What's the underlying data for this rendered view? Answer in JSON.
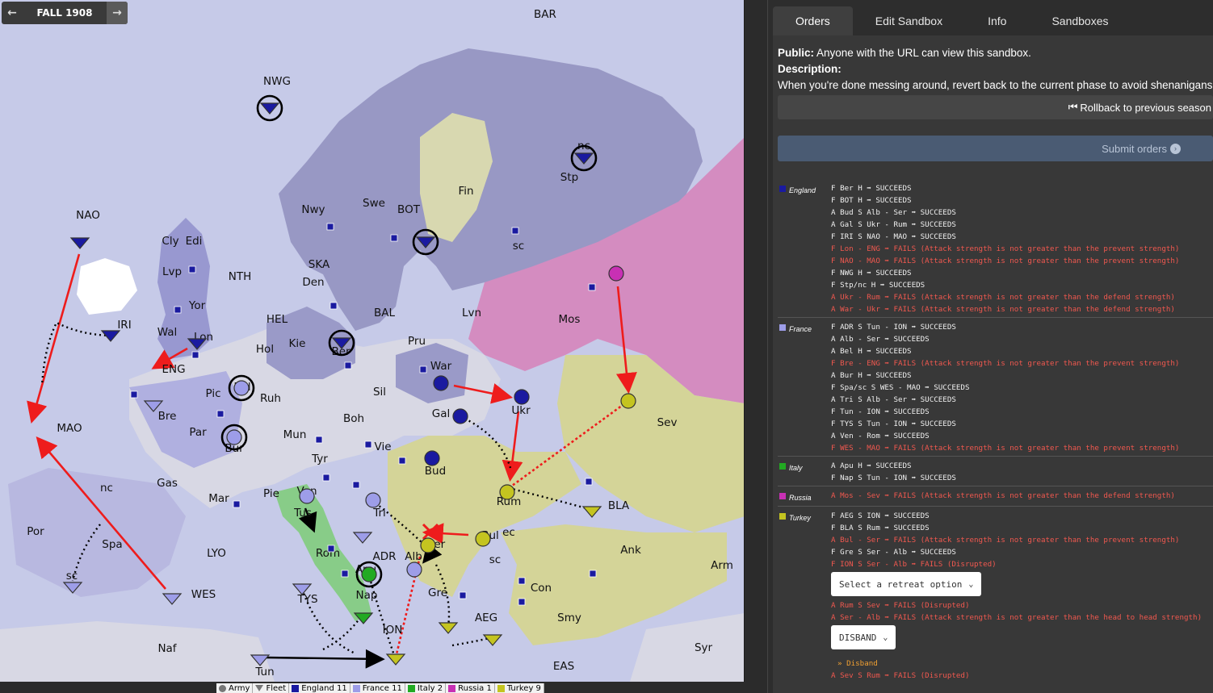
{
  "season": {
    "label": "FALL 1908",
    "prev_icon": "arrow-left-icon",
    "next_icon": "arrow-right-icon"
  },
  "colors": {
    "sea": "#c6cae8",
    "land": "#dcdce6",
    "england": "#1a1aa0",
    "france": "#9d9de8",
    "italy": "#22aa22",
    "russia": "#c830b4",
    "turkey": "#c4c420"
  },
  "map_labels": [
    "BAR",
    "NWG",
    "NAO",
    "Cly",
    "Edi",
    "Lvp",
    "Yor",
    "NTH",
    "Wal",
    "IRI",
    "Lon",
    "ENG",
    "Bre",
    "Pic",
    "Bel",
    "Hol",
    "HEL",
    "Kie",
    "Ber",
    "BAL",
    "Den",
    "SKA",
    "Nwy",
    "Swe",
    "BOT",
    "Fin",
    "Stp",
    "nc",
    "sc",
    "Lvn",
    "Mos",
    "Pru",
    "War",
    "Sil",
    "Ruh",
    "Bur",
    "Par",
    "Gas",
    "Mun",
    "Boh",
    "Tyr",
    "Vie",
    "Gal",
    "Ukr",
    "Sev",
    "Bud",
    "Rum",
    "Ser",
    "Bul",
    "ec",
    "sc",
    "BLA",
    "Ank",
    "Arm",
    "Con",
    "Smy",
    "Syr",
    "AEG",
    "EAS",
    "Gre",
    "Alb",
    "ION",
    "ADR",
    "Apu",
    "Nap",
    "Rom",
    "Tus",
    "Ven",
    "Tri",
    "Pie",
    "Mar",
    "Spa",
    "nc",
    "sc",
    "Por",
    "MAO",
    "LYO",
    "WES",
    "TYS",
    "Naf",
    "Tun"
  ],
  "legend": [
    {
      "label": "Army",
      "kind": "army"
    },
    {
      "label": "Fleet",
      "kind": "fleet"
    },
    {
      "label": "England 11",
      "color": "#1a1aa0"
    },
    {
      "label": "France 11",
      "color": "#9d9de8"
    },
    {
      "label": "Italy 2",
      "color": "#22aa22"
    },
    {
      "label": "Russia 1",
      "color": "#c830b4"
    },
    {
      "label": "Turkey 9",
      "color": "#c4c420"
    }
  ],
  "tabs": [
    "Orders",
    "Edit Sandbox",
    "Info",
    "Sandboxes"
  ],
  "info": {
    "public_label": "Public:",
    "public_text": "Anyone with the URL can view this sandbox.",
    "description_label": "Description:",
    "description_text": "When you're done messing around, revert back to the current phase to avoid shenanigans"
  },
  "rollback_label": "Rollback to previous season",
  "submit_label": "Submit orders",
  "nations": [
    {
      "name": "England",
      "color": "#1a1aa0",
      "orders": [
        {
          "text": "F Ber H ➡ SUCCEEDS",
          "fail": false
        },
        {
          "text": "F BOT H ➡ SUCCEEDS",
          "fail": false
        },
        {
          "text": "A Bud S Alb - Ser ➡ SUCCEEDS",
          "fail": false
        },
        {
          "text": "A Gal S Ukr - Rum ➡ SUCCEEDS",
          "fail": false
        },
        {
          "text": "F IRI S NAO - MAO ➡ SUCCEEDS",
          "fail": false
        },
        {
          "text": "F Lon - ENG ➡ FAILS (Attack strength is not greater than the prevent strength)",
          "fail": true
        },
        {
          "text": "F NAO - MAO ➡ FAILS (Attack strength is not greater than the prevent strength)",
          "fail": true
        },
        {
          "text": "F NWG H ➡ SUCCEEDS",
          "fail": false
        },
        {
          "text": "F Stp/nc H ➡ SUCCEEDS",
          "fail": false
        },
        {
          "text": "A Ukr - Rum ➡ FAILS (Attack strength is not greater than the defend strength)",
          "fail": true
        },
        {
          "text": "A War - Ukr ➡ FAILS (Attack strength is not greater than the defend strength)",
          "fail": true
        }
      ]
    },
    {
      "name": "France",
      "color": "#9d9de8",
      "orders": [
        {
          "text": "F ADR S Tun - ION ➡ SUCCEEDS",
          "fail": false
        },
        {
          "text": "A Alb - Ser ➡ SUCCEEDS",
          "fail": false
        },
        {
          "text": "A Bel H ➡ SUCCEEDS",
          "fail": false
        },
        {
          "text": "F Bre - ENG ➡ FAILS (Attack strength is not greater than the prevent strength)",
          "fail": true
        },
        {
          "text": "A Bur H ➡ SUCCEEDS",
          "fail": false
        },
        {
          "text": "F Spa/sc S WES - MAO ➡ SUCCEEDS",
          "fail": false
        },
        {
          "text": "A Tri S Alb - Ser ➡ SUCCEEDS",
          "fail": false
        },
        {
          "text": "F Tun - ION ➡ SUCCEEDS",
          "fail": false
        },
        {
          "text": "F TYS S Tun - ION ➡ SUCCEEDS",
          "fail": false
        },
        {
          "text": "A Ven - Rom ➡ SUCCEEDS",
          "fail": false
        },
        {
          "text": "F WES - MAO ➡ FAILS (Attack strength is not greater than the prevent strength)",
          "fail": true
        }
      ]
    },
    {
      "name": "Italy",
      "color": "#22aa22",
      "orders": [
        {
          "text": "A Apu H ➡ SUCCEEDS",
          "fail": false
        },
        {
          "text": "F Nap S Tun - ION ➡ SUCCEEDS",
          "fail": false
        }
      ]
    },
    {
      "name": "Russia",
      "color": "#c830b4",
      "orders": [
        {
          "text": "A Mos - Sev ➡ FAILS (Attack strength is not greater than the defend strength)",
          "fail": true
        }
      ]
    },
    {
      "name": "Turkey",
      "color": "#c4c420",
      "orders": [
        {
          "text": "F AEG S ION ➡ SUCCEEDS",
          "fail": false
        },
        {
          "text": "F BLA S Rum ➡ SUCCEEDS",
          "fail": false
        },
        {
          "text": "A Bul - Ser ➡ FAILS (Attack strength is not greater than the prevent strength)",
          "fail": true
        },
        {
          "text": "F Gre S Ser - Alb ➡ SUCCEEDS",
          "fail": false
        },
        {
          "text": "F ION S Ser - Alb ➡ FAILS (Disrupted)",
          "fail": true
        },
        {
          "select": "Select a retreat option"
        },
        {
          "text": "A Rum S Sev ➡ FAILS (Disrupted)",
          "fail": true
        },
        {
          "text": "A Ser - Alb ➡ FAILS (Attack strength is not greater than the head to head strength)",
          "fail": true
        },
        {
          "select": "DISBAND"
        },
        {
          "disband": "» Disband"
        },
        {
          "text": "A Sev S Rum ➡ FAILS (Disrupted)",
          "fail": true
        }
      ]
    }
  ]
}
